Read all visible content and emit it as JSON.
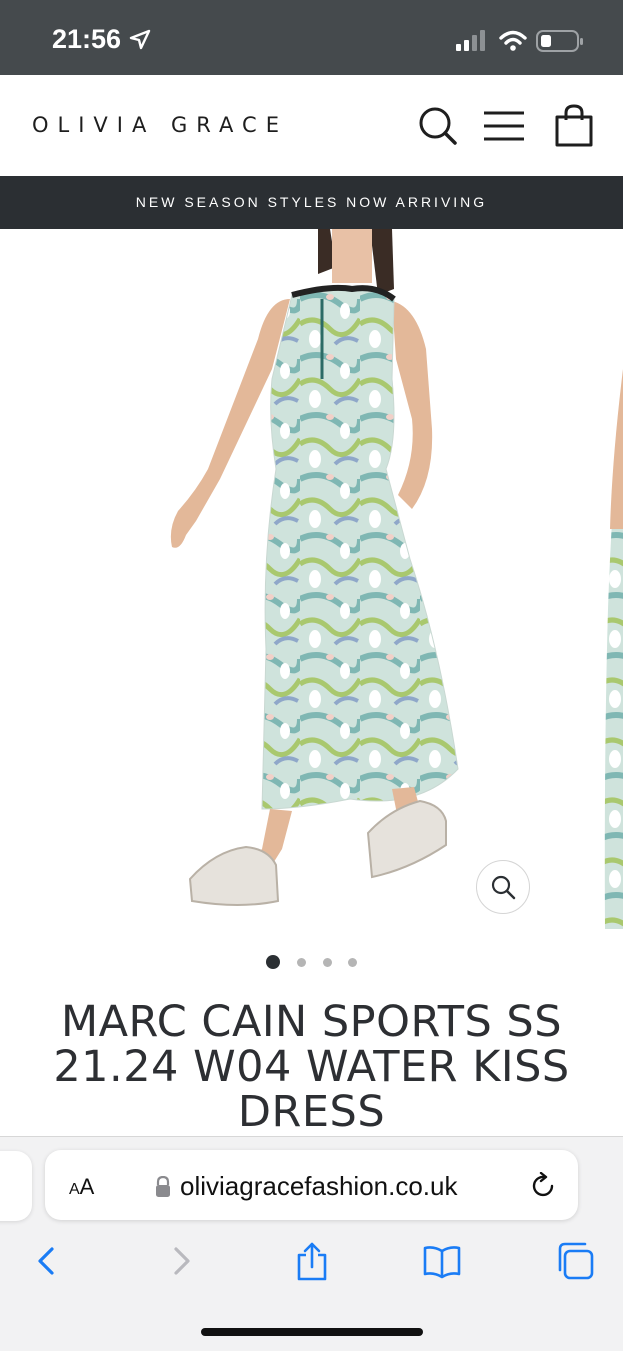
{
  "status_bar": {
    "time": "21:56",
    "icons": [
      "location-arrow-icon",
      "cellular-signal-icon",
      "wifi-icon",
      "battery-icon"
    ]
  },
  "header": {
    "logo": "OLIVIA GRACE",
    "icons": [
      "search-icon",
      "menu-icon",
      "shopping-bag-icon"
    ]
  },
  "banner": {
    "text": "NEW SEASON STYLES NOW ARRIVING"
  },
  "gallery": {
    "image_count": 4,
    "active_index": 0,
    "zoom_icon": "zoom-magnifier-icon"
  },
  "product": {
    "title": "MARC CAIN SPORTS SS 21.24 W04 WATER KISS DRESS"
  },
  "browser": {
    "text_size_button": "AA",
    "url": "oliviagracefashion.co.uk",
    "toolbar_icons": [
      "back-chevron-icon",
      "forward-chevron-icon",
      "share-icon",
      "bookmarks-icon",
      "tabs-icon"
    ]
  },
  "colors": {
    "status_bar": "#454a4d",
    "banner": "#2b2f33",
    "safari_blue": "#1a7cf5",
    "text_dark": "#2d2f33"
  }
}
